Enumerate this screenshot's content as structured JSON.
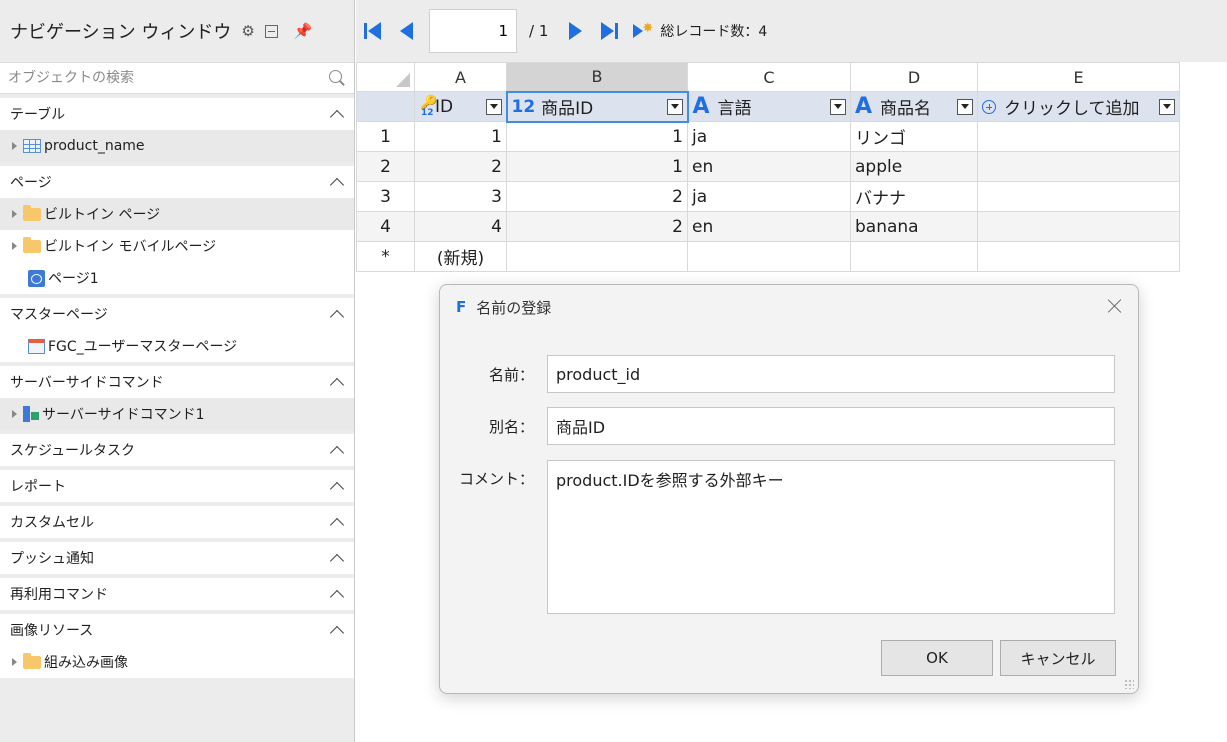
{
  "nav": {
    "title": "ナビゲーション ウィンドウ",
    "search_placeholder": "オブジェクトの検索",
    "sections": {
      "tables": {
        "label": "テーブル",
        "items": [
          "product_name"
        ]
      },
      "pages": {
        "label": "ページ",
        "items": [
          "ビルトイン ページ",
          "ビルトイン モバイルページ",
          "ページ1"
        ]
      },
      "master_pages": {
        "label": "マスターページ",
        "items": [
          "FGC_ユーザーマスターページ"
        ]
      },
      "server_commands": {
        "label": "サーバーサイドコマンド",
        "items": [
          "サーバーサイドコマンド1"
        ]
      },
      "schedule_tasks": {
        "label": "スケジュールタスク"
      },
      "reports": {
        "label": "レポート"
      },
      "custom_cells": {
        "label": "カスタムセル"
      },
      "push": {
        "label": "プッシュ通知"
      },
      "reusable_commands": {
        "label": "再利用コマンド"
      },
      "image_resources": {
        "label": "画像リソース",
        "items": [
          "組み込み画像"
        ]
      }
    }
  },
  "toolbar": {
    "current_page": "1",
    "total_pages": "/ 1",
    "record_count": "総レコード数：4"
  },
  "grid": {
    "column_letters": [
      "A",
      "B",
      "C",
      "D",
      "E"
    ],
    "fields": [
      "ID",
      "商品ID",
      "言語",
      "商品名",
      "クリックして追加"
    ],
    "type_icons": {
      "number": "12",
      "text": "A"
    },
    "rows": [
      {
        "num": "1",
        "id": "1",
        "product_id": "1",
        "lang": "ja",
        "name": "リンゴ"
      },
      {
        "num": "2",
        "id": "2",
        "product_id": "1",
        "lang": "en",
        "name": "apple"
      },
      {
        "num": "3",
        "id": "3",
        "product_id": "2",
        "lang": "ja",
        "name": "バナナ"
      },
      {
        "num": "4",
        "id": "4",
        "product_id": "2",
        "lang": "en",
        "name": "banana"
      }
    ],
    "new_row": {
      "marker": "*",
      "label": "(新規)"
    }
  },
  "dialog": {
    "app_glyph": "F",
    "title": "名前の登録",
    "name_label": "名前：",
    "name_value": "product_id",
    "alias_label": "別名：",
    "alias_value": "商品ID",
    "comment_label": "コメント：",
    "comment_value": "product.IDを参照する外部キー",
    "ok_label": "OK",
    "cancel_label": "キャンセル"
  },
  "colors": {
    "accent": "#1f6fe0",
    "selected_column": "#d4d4d4",
    "field_header": "#dde3ee",
    "active_border": "#3e8ee8",
    "folder": "#f7c76a"
  }
}
